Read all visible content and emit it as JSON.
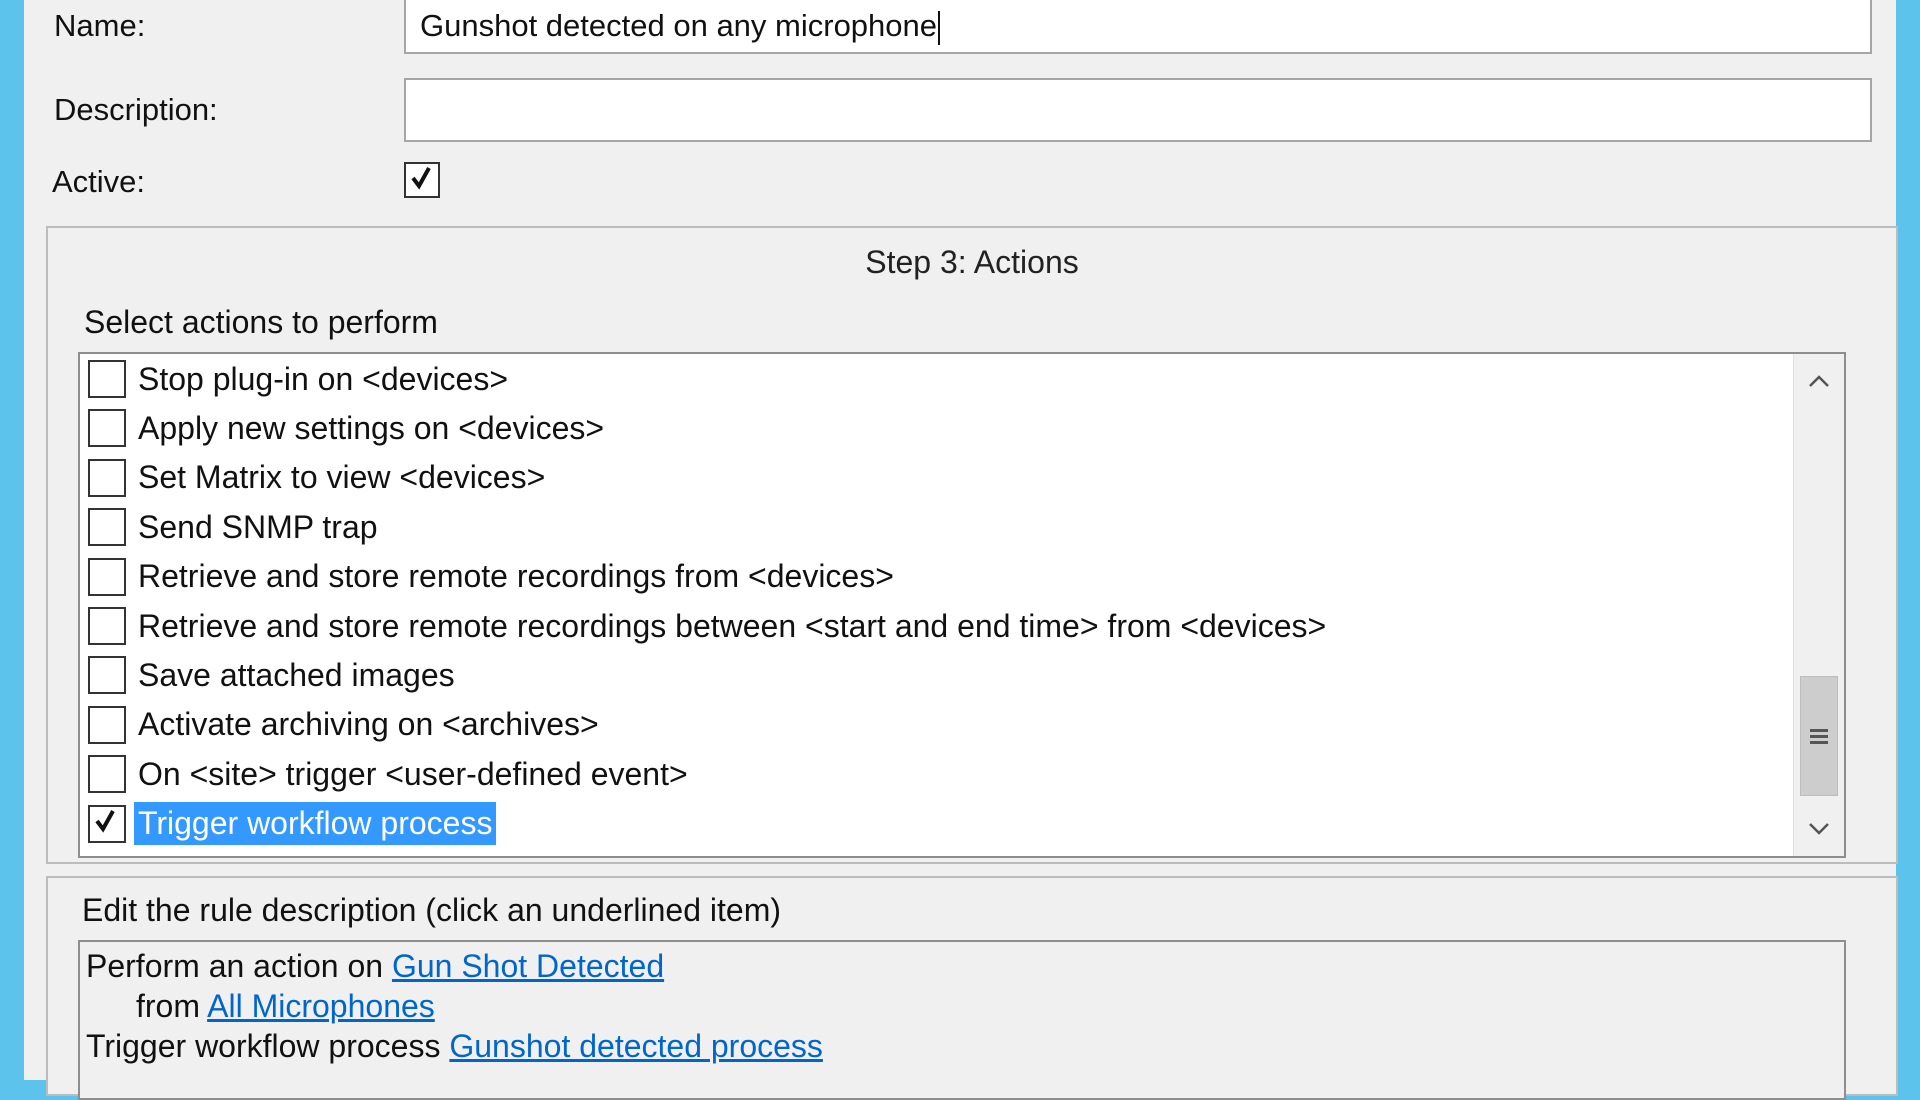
{
  "form": {
    "name_label": "Name:",
    "name_value": "Gunshot detected on any microphone",
    "description_label": "Description:",
    "description_value": "",
    "active_label": "Active:",
    "active_checked": true
  },
  "step": {
    "title": "Step 3: Actions",
    "select_label": "Select actions to perform",
    "actions": [
      {
        "label": "Stop plug-in on <devices>",
        "checked": false
      },
      {
        "label": "Apply new settings on <devices>",
        "checked": false
      },
      {
        "label": "Set Matrix to view <devices>",
        "checked": false
      },
      {
        "label": "Send SNMP trap",
        "checked": false
      },
      {
        "label": "Retrieve and store remote recordings from <devices>",
        "checked": false
      },
      {
        "label": "Retrieve and store remote recordings between <start and end time> from <devices>",
        "checked": false
      },
      {
        "label": "Save attached images",
        "checked": false
      },
      {
        "label": "Activate archiving on <archives>",
        "checked": false
      },
      {
        "label": "On <site> trigger <user-defined event>",
        "checked": false
      },
      {
        "label": "Trigger workflow process",
        "checked": true,
        "selected": true
      }
    ]
  },
  "rule": {
    "title": "Edit the rule description (click an underlined item)",
    "line1_prefix": "Perform an action on ",
    "line1_link": "Gun Shot Detected",
    "line2_prefix": "from ",
    "line2_link": "All Microphones",
    "line3_prefix": "Trigger workflow process ",
    "line3_link": "Gunshot detected process"
  },
  "colors": {
    "background": "#5bc3ec",
    "dialog": "#f0f0f0",
    "selection": "#3399ff",
    "link": "#0066cc"
  }
}
